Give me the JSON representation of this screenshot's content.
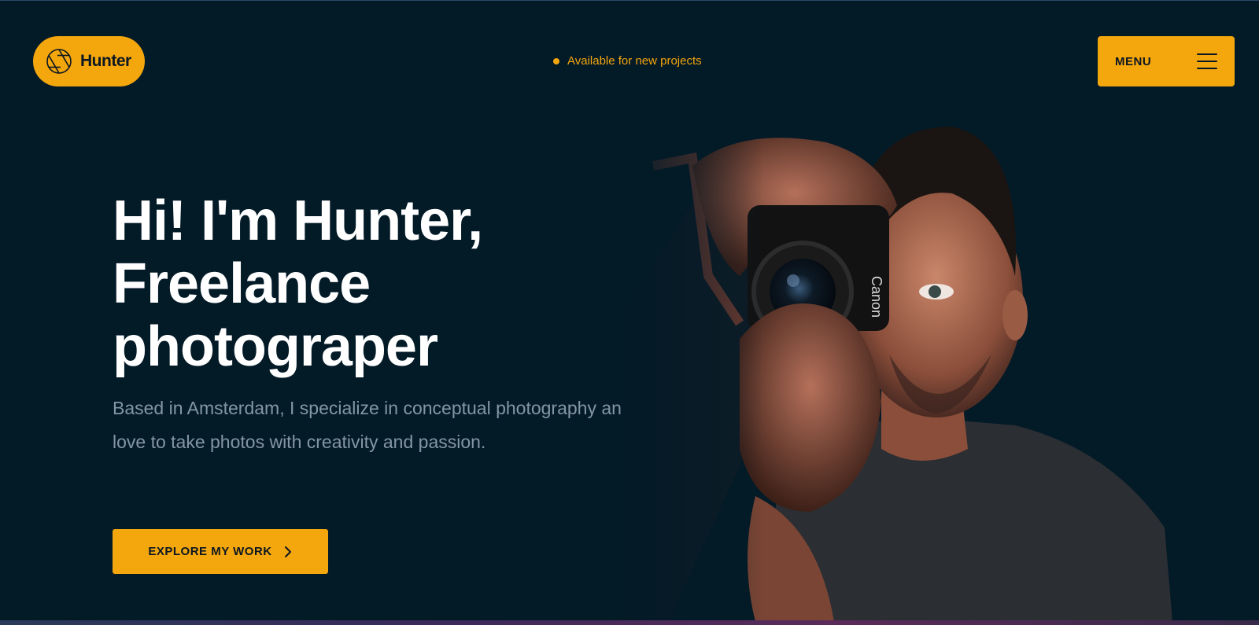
{
  "brand": {
    "name": "Hunter",
    "logo_icon": "aperture-icon",
    "accent_color": "#f4a60d",
    "background_color": "#031a27"
  },
  "header": {
    "availability": "Available for new projects",
    "menu_label": "MENU",
    "menu_icon": "hamburger-icon"
  },
  "hero": {
    "headline_lines": [
      "Hi! I'm Hunter,",
      "Freelance",
      "photograper"
    ],
    "description": "Based in Amsterdam, I specialize in conceptual photography and love to take photos with creativity and passion.",
    "cta_label": "EXPLORE MY WORK",
    "cta_icon": "chevron-right-icon",
    "image_alt": "Photographer holding a Canon camera"
  }
}
